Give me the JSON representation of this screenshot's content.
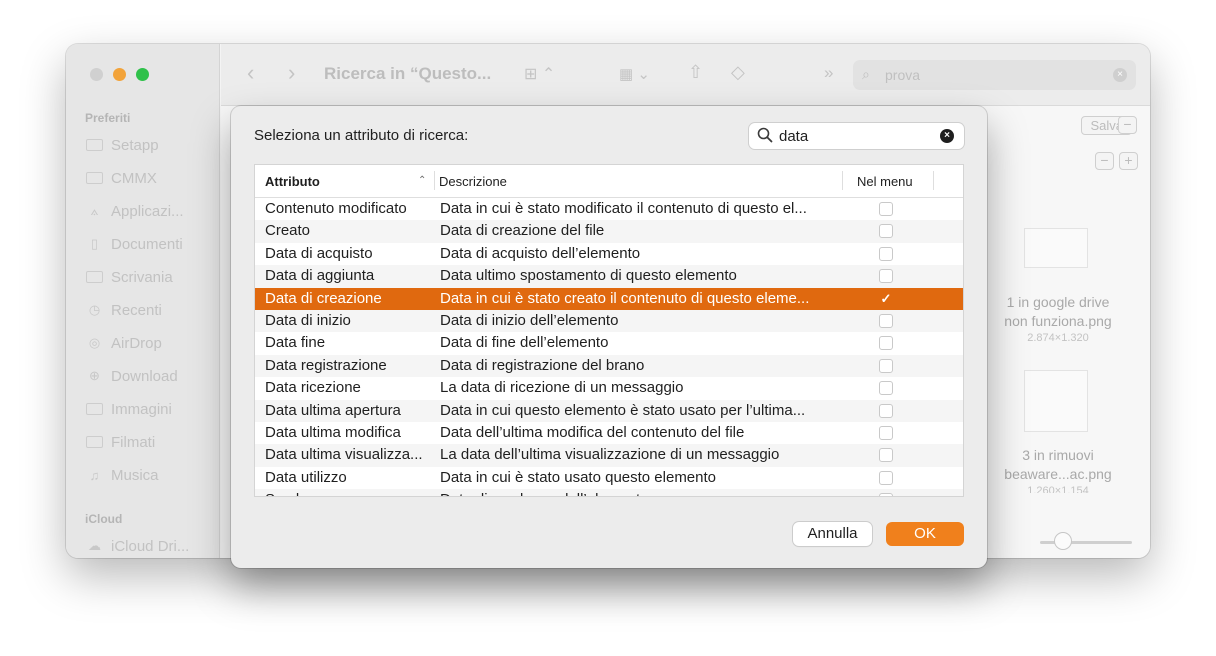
{
  "finder": {
    "sidebar": {
      "section_favorites": "Preferiti",
      "items": [
        {
          "label": "Setapp",
          "icon": "folder-icon"
        },
        {
          "label": "CMMX",
          "icon": "folder-icon"
        },
        {
          "label": "Applicazi...",
          "icon": "applications-icon"
        },
        {
          "label": "Documenti",
          "icon": "document-icon"
        },
        {
          "label": "Scrivania",
          "icon": "desktop-icon"
        },
        {
          "label": "Recenti",
          "icon": "clock-icon"
        },
        {
          "label": "AirDrop",
          "icon": "airdrop-icon"
        },
        {
          "label": "Download",
          "icon": "download-icon"
        },
        {
          "label": "Immagini",
          "icon": "photo-icon"
        },
        {
          "label": "Filmati",
          "icon": "film-icon"
        },
        {
          "label": "Musica",
          "icon": "music-icon"
        }
      ],
      "section_icloud": "iCloud",
      "icloud_item": "iCloud Dri..."
    },
    "toolbar": {
      "title": "Ricerca in “Questo...",
      "search_value": "prova"
    },
    "main": {
      "save_label": "Salva",
      "files": [
        {
          "name_line1": "1 in google drive",
          "name_line2": "non funziona.png",
          "dimensions": "2.874×1.320"
        },
        {
          "name_line1": "3 in rimuovi",
          "name_line2": "beaware...ac.png",
          "dimensions": "1.260×1.154"
        }
      ]
    }
  },
  "dialog": {
    "label": "Seleziona un attributo di ricerca:",
    "search_value": "data",
    "columns": {
      "attribute": "Attributo",
      "description": "Descrizione",
      "in_menu": "Nel menu"
    },
    "rows": [
      {
        "attribute": "Contenuto modificato",
        "description": "Data in cui è stato modificato il contenuto di questo el...",
        "checked": false
      },
      {
        "attribute": "Creato",
        "description": "Data di creazione del file",
        "checked": false
      },
      {
        "attribute": "Data di acquisto",
        "description": "Data di acquisto dell’elemento",
        "checked": false
      },
      {
        "attribute": "Data di aggiunta",
        "description": "Data ultimo spostamento di questo elemento",
        "checked": false
      },
      {
        "attribute": "Data di creazione",
        "description": "Data in cui è stato creato il contenuto di questo eleme...",
        "checked": true,
        "selected": true
      },
      {
        "attribute": "Data di inizio",
        "description": "Data di inizio dell’elemento",
        "checked": false
      },
      {
        "attribute": "Data fine",
        "description": "Data di fine dell’elemento",
        "checked": false
      },
      {
        "attribute": "Data registrazione",
        "description": "Data di registrazione del brano",
        "checked": false
      },
      {
        "attribute": "Data ricezione",
        "description": "La data di ricezione di un messaggio",
        "checked": false
      },
      {
        "attribute": "Data ultima apertura",
        "description": "Data in cui questo elemento è stato usato per l’ultima...",
        "checked": false
      },
      {
        "attribute": "Data ultima modifica",
        "description": "Data dell’ultima modifica del contenuto del file",
        "checked": false
      },
      {
        "attribute": "Data ultima visualizza...",
        "description": "La data dell’ultima visualizzazione di un messaggio",
        "checked": false
      },
      {
        "attribute": "Data utilizzo",
        "description": "Data in cui è stato usato questo elemento",
        "checked": false
      },
      {
        "attribute": "Scadenza",
        "description": "Data di scadenza dell’elemento",
        "checked": false
      }
    ],
    "cancel_label": "Annulla",
    "ok_label": "OK",
    "accent_color": "#e0690f"
  }
}
